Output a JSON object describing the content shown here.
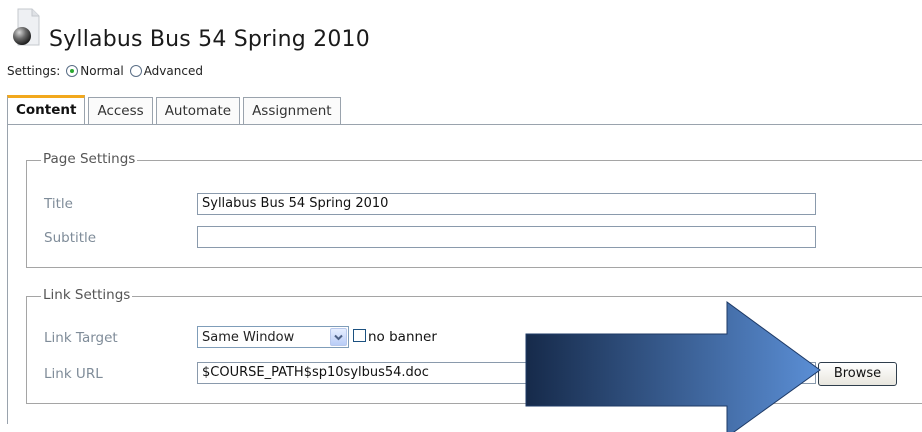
{
  "page": {
    "title": "Syllabus Bus 54 Spring 2010"
  },
  "settings": {
    "label": "Settings:",
    "options": [
      {
        "label": "Normal",
        "selected": true
      },
      {
        "label": "Advanced",
        "selected": false
      }
    ]
  },
  "tabs": [
    {
      "label": "Content",
      "active": true
    },
    {
      "label": "Access",
      "active": false
    },
    {
      "label": "Automate",
      "active": false
    },
    {
      "label": "Assignment",
      "active": false
    }
  ],
  "page_settings": {
    "legend": "Page Settings",
    "title_label": "Title",
    "title_value": "Syllabus Bus 54 Spring 2010",
    "subtitle_label": "Subtitle",
    "subtitle_value": ""
  },
  "link_settings": {
    "legend": "Link Settings",
    "target_label": "Link Target",
    "target_value": "Same Window",
    "no_banner_label": "no banner",
    "no_banner_checked": false,
    "url_label": "Link URL",
    "url_value": "$COURSE_PATH$sp10sylbus54.doc",
    "browse_label": "Browse"
  },
  "colors": {
    "active_tab_accent": "#f2a81d",
    "arrow_dark": "#162a4a",
    "arrow_light": "#5b8fd6"
  }
}
